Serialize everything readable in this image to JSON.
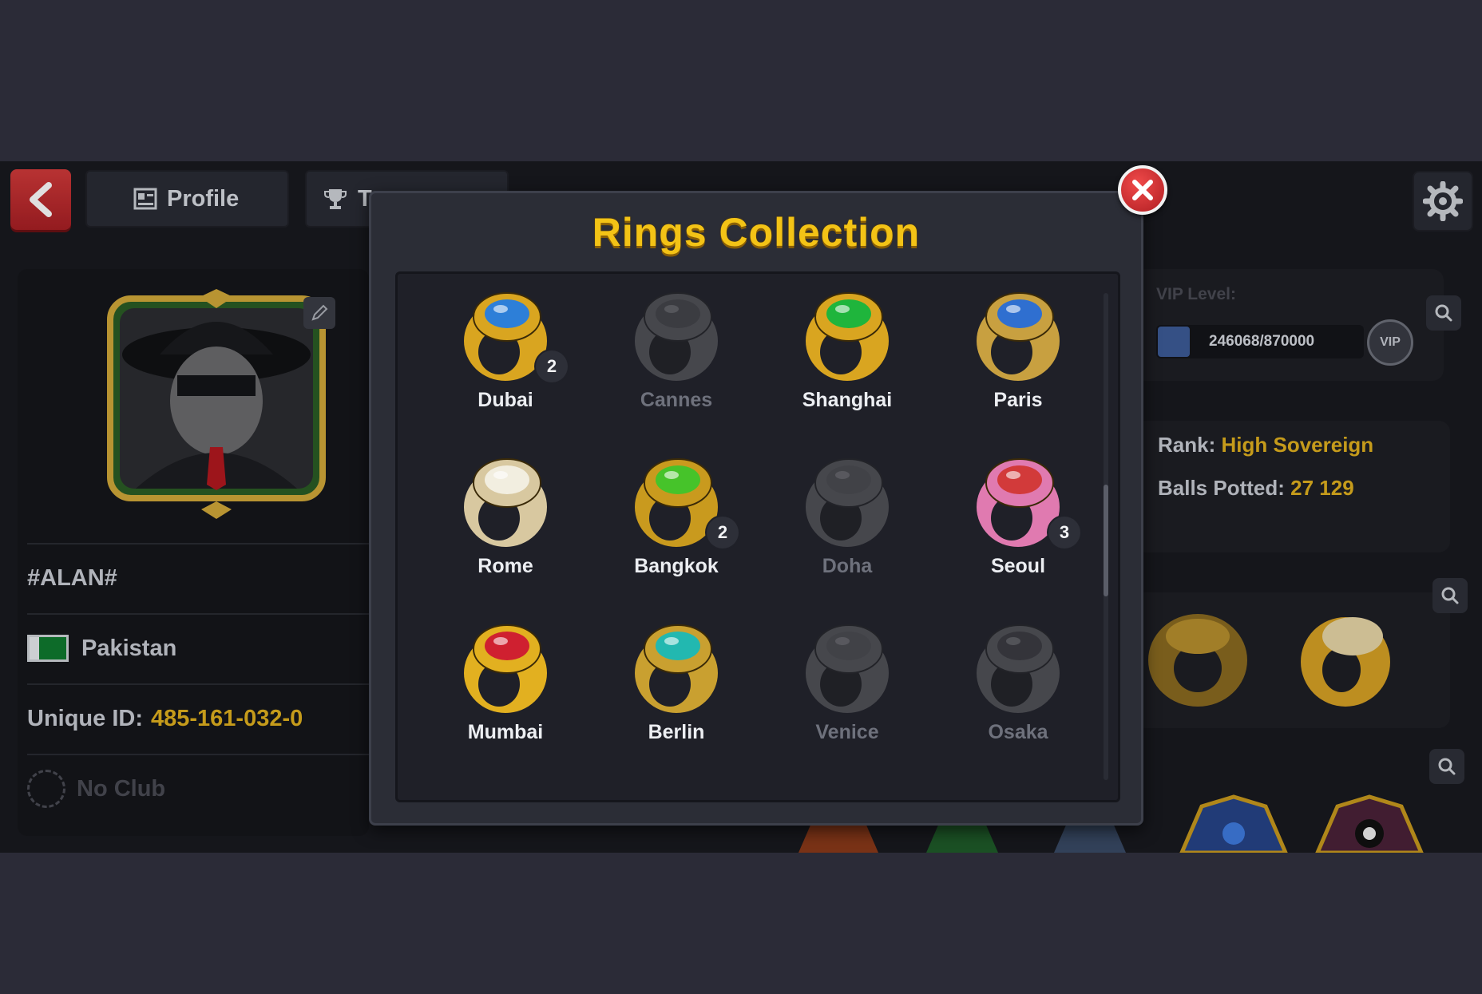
{
  "header": {
    "tab_profile": "Profile",
    "tab_trophies": "Tr"
  },
  "player": {
    "name": "#ALAN#",
    "country": "Pakistan",
    "unique_id_label": "Unique ID:",
    "unique_id": "485-161-032-0",
    "club": "No Club"
  },
  "vip": {
    "label": "VIP Level:",
    "progress_text": "246068/870000",
    "badge": "VIP",
    "progress_fraction": 0.283
  },
  "stats": {
    "rank_label": "Rank:",
    "rank_value": "High Sovereign",
    "balls_label": "Balls Potted:",
    "balls_value": "27 129"
  },
  "modal": {
    "title": "Rings Collection",
    "rings": [
      {
        "name": "Dubai",
        "count": "2",
        "locked": false,
        "band": "#d9a520",
        "gem": "#2d7fd8"
      },
      {
        "name": "Cannes",
        "count": "",
        "locked": true,
        "band": "#9a9aa0",
        "gem": "#777780"
      },
      {
        "name": "Shanghai",
        "count": "",
        "locked": false,
        "band": "#d9a520",
        "gem": "#1fb53c"
      },
      {
        "name": "Paris",
        "count": "",
        "locked": false,
        "band": "#c8a040",
        "gem": "#2f6fd0"
      },
      {
        "name": "Rome",
        "count": "",
        "locked": false,
        "band": "#d8c8a0",
        "gem": "#f2eee0"
      },
      {
        "name": "Bangkok",
        "count": "2",
        "locked": false,
        "band": "#c99a1e",
        "gem": "#46c32a"
      },
      {
        "name": "Doha",
        "count": "",
        "locked": true,
        "band": "#9a9aa0",
        "gem": "#888890"
      },
      {
        "name": "Seoul",
        "count": "3",
        "locked": false,
        "band": "#e07ab0",
        "gem": "#d23a3a"
      },
      {
        "name": "Mumbai",
        "count": "",
        "locked": false,
        "band": "#e2b020",
        "gem": "#cf2030"
      },
      {
        "name": "Berlin",
        "count": "",
        "locked": false,
        "band": "#c9a030",
        "gem": "#22b8b0"
      },
      {
        "name": "Venice",
        "count": "",
        "locked": true,
        "band": "#9a9aa0",
        "gem": "#888890"
      },
      {
        "name": "Osaka",
        "count": "",
        "locked": true,
        "band": "#9a9aa0",
        "gem": "#a05040"
      }
    ]
  },
  "icons": {
    "back": "chevron-left-icon",
    "settings": "gear-icon",
    "close": "close-icon",
    "search": "search-icon"
  },
  "colors": {
    "accent_gold": "#e1b11f",
    "title_gold": "#f3c316",
    "back_red": "#c22c30"
  }
}
